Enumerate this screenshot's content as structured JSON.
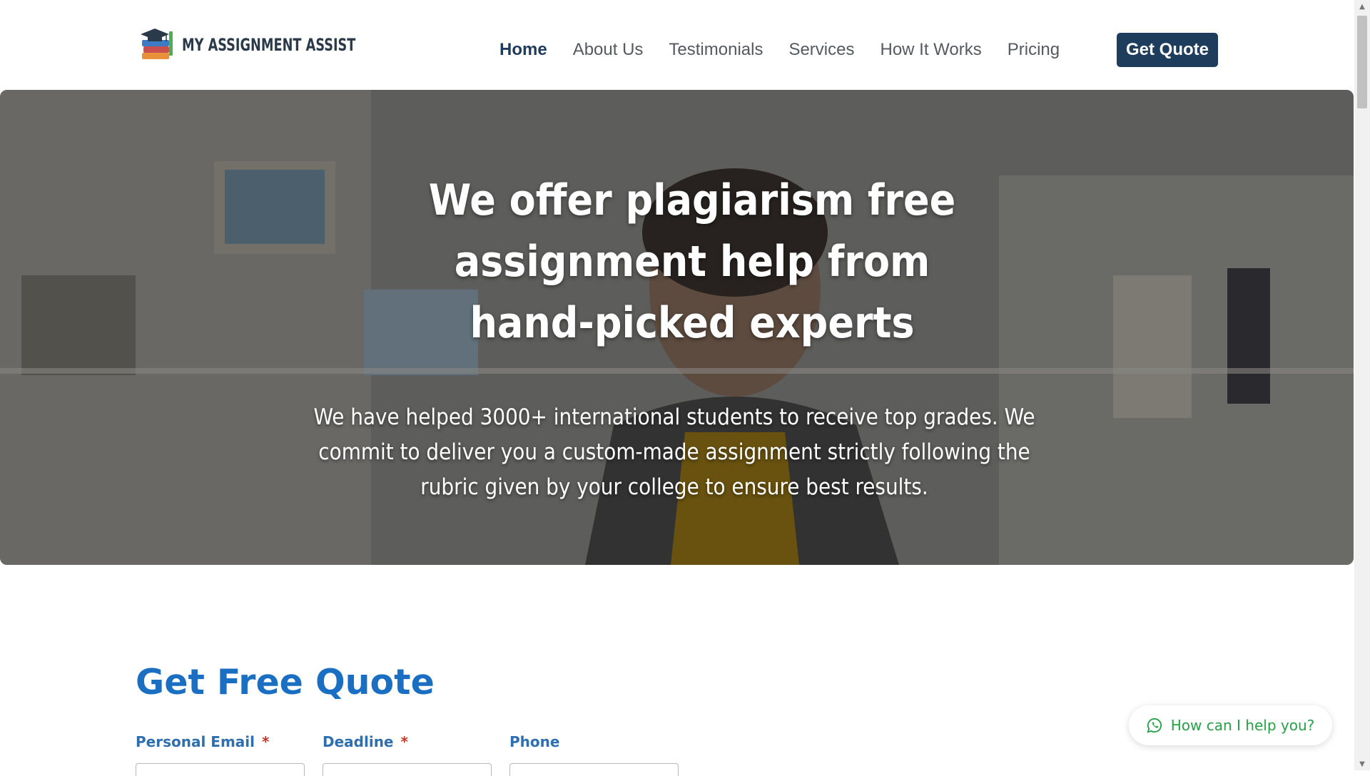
{
  "brand": {
    "name": "MY ASSIGNMENT ASSIST"
  },
  "nav": {
    "items": [
      {
        "label": "Home",
        "active": true
      },
      {
        "label": "About Us",
        "active": false
      },
      {
        "label": "Testimonials",
        "active": false
      },
      {
        "label": "Services",
        "active": false
      },
      {
        "label": "How It Works",
        "active": false
      },
      {
        "label": "Pricing",
        "active": false
      }
    ],
    "cta_label": "Get Quote"
  },
  "hero": {
    "title": "We offer plagiarism free assignment help from hand-picked experts",
    "subtitle": "We have helped 3000+ international students to receive top grades. We commit to deliver you a custom-made assignment strictly following the rubric given by your college to ensure best results."
  },
  "quote_form": {
    "title": "Get Free Quote",
    "fields": [
      {
        "label": "Personal Email",
        "required": true,
        "value": "",
        "placeholder": ""
      },
      {
        "label": "Deadline",
        "required": true,
        "value": "",
        "placeholder": ""
      },
      {
        "label": "Phone",
        "required": false,
        "value": "",
        "placeholder": ""
      }
    ],
    "required_marker": "*"
  },
  "chat_widget": {
    "label": "How can I help you?",
    "icon": "whatsapp-icon"
  },
  "colors": {
    "brand_dark": "#1e3c5c",
    "quote_blue": "#1a6fc2",
    "label_blue": "#2d6fb0",
    "required_red": "#c0392b",
    "whatsapp_green": "#25a244"
  }
}
